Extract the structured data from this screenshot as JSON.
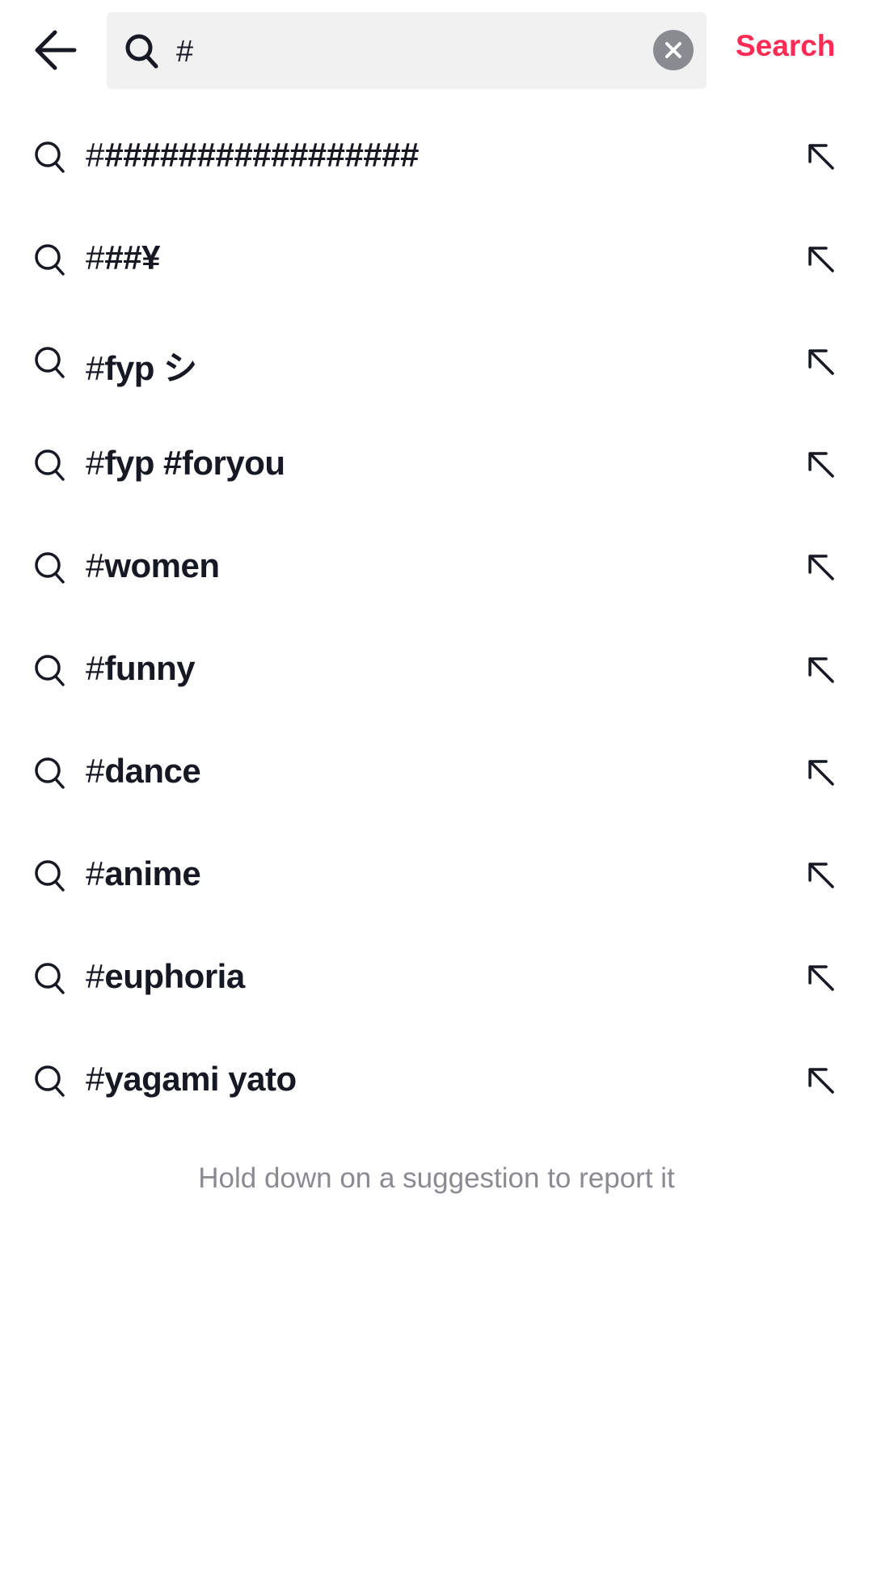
{
  "header": {
    "query": "#",
    "search_label": "Search",
    "accent_color": "#fe2c55"
  },
  "suggestions": [
    {
      "typed": "#",
      "rest": "#################"
    },
    {
      "typed": "#",
      "rest": "##¥"
    },
    {
      "typed": "#",
      "rest": "fyp シ"
    },
    {
      "typed": "#",
      "rest": "fyp #foryou"
    },
    {
      "typed": "#",
      "rest": "women"
    },
    {
      "typed": "#",
      "rest": "funny"
    },
    {
      "typed": "#",
      "rest": "dance"
    },
    {
      "typed": "#",
      "rest": "anime"
    },
    {
      "typed": "#",
      "rest": "euphoria"
    },
    {
      "typed": "#",
      "rest": "yagami yato"
    }
  ],
  "footer": {
    "hint": "Hold down on a suggestion to report it"
  }
}
